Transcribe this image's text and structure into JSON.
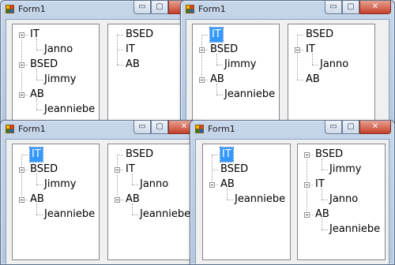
{
  "window_title": "Form1",
  "caption_buttons": {
    "minimize": "▭",
    "maximize": "▢",
    "close": "✕"
  },
  "windows": [
    {
      "left_tree": {
        "nodes": [
          "IT",
          "Janno",
          "BSED",
          "Jimmy",
          "AB",
          "Jeanniebe"
        ]
      },
      "right_tree": {
        "nodes": [
          "BSED",
          "IT",
          "AB"
        ]
      }
    },
    {
      "left_tree": {
        "nodes": [
          "IT",
          "BSED",
          "Jimmy",
          "AB",
          "Jeanniebe"
        ],
        "selected": "IT"
      },
      "right_tree": {
        "nodes": [
          "BSED",
          "IT",
          "Janno",
          "AB"
        ]
      }
    },
    {
      "left_tree": {
        "nodes": [
          "IT",
          "BSED",
          "Jimmy",
          "AB",
          "Jeanniebe"
        ],
        "selected": "IT"
      },
      "right_tree": {
        "nodes": [
          "BSED",
          "IT",
          "Janno",
          "AB",
          "Jeanniebe"
        ]
      }
    },
    {
      "left_tree": {
        "nodes": [
          "IT",
          "BSED",
          "AB",
          "Jeanniebe"
        ],
        "selected": "IT"
      },
      "right_tree": {
        "nodes": [
          "BSED",
          "Jimmy",
          "IT",
          "Janno",
          "AB",
          "Jeanniebe"
        ]
      }
    }
  ]
}
